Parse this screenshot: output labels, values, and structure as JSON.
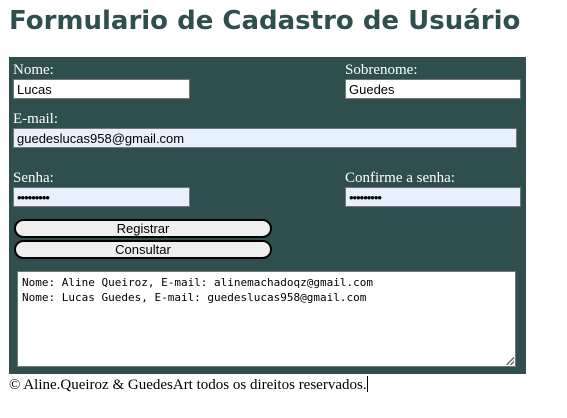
{
  "page": {
    "title": "Formulario de Cadastro de Usuário"
  },
  "form": {
    "nome": {
      "label": "Nome:",
      "value": "Lucas"
    },
    "sobrenome": {
      "label": "Sobrenome:",
      "value": "Guedes"
    },
    "email": {
      "label": "E-mail:",
      "value": "guedeslucas958@gmail.com"
    },
    "senha": {
      "label": "Senha:",
      "value": "•••••••••"
    },
    "confirme_senha": {
      "label": "Confirme a senha:",
      "value": "•••••••••"
    },
    "registrar_label": "Registrar",
    "consultar_label": "Consultar"
  },
  "results": {
    "lines": [
      "Nome: Aline Queiroz, E-mail: alinemachadoqz@gmail.com",
      "Nome: Lucas Guedes, E-mail: guedeslucas958@gmail.com"
    ]
  },
  "footer": {
    "text": "© Aline.Queiroz & GuedesArt todos os direitos reservados."
  },
  "colors": {
    "panel": "#2f4f4f",
    "title": "#2f4f4f",
    "autofill": "#e8f0fe"
  }
}
